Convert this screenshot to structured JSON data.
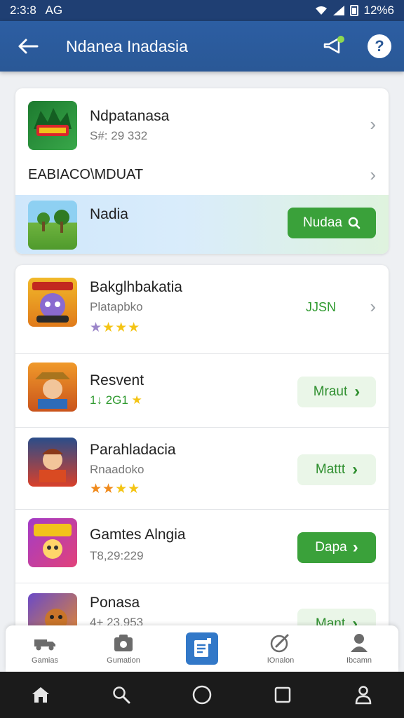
{
  "status_bar": {
    "time": "2:3:8",
    "carrier": "AG",
    "clock_right": "12%6"
  },
  "app_bar": {
    "title": "Ndanea Inadasia"
  },
  "featured_card": {
    "top_item": {
      "title": "Ndpatanasa",
      "subtitle": "S#: 29 332"
    },
    "section_row": {
      "label": "EABIACO\\MDUAT"
    },
    "highlight_item": {
      "title": "Nadia",
      "button_label": "Nudaa"
    }
  },
  "game_list": [
    {
      "title": "Bakglhbakatia",
      "subtitle": "Platapbko",
      "action": "JJSN",
      "action_style": "text",
      "rating": [
        "purple",
        "gold",
        "gold",
        "gold"
      ]
    },
    {
      "title": "Resvent",
      "subtitle": "1↓ 2G1",
      "action": "Mraut",
      "action_style": "light",
      "rating": [
        "gold"
      ]
    },
    {
      "title": "Parahladacia",
      "subtitle": "Rnaadoko",
      "action": "Mattt",
      "action_style": "light",
      "rating": [
        "orange",
        "orange",
        "gold",
        "gold"
      ]
    },
    {
      "title": "Gamtes Alngia",
      "subtitle": "T8,29:229",
      "action": "Dapa",
      "action_style": "green",
      "rating": []
    },
    {
      "title": "Ponasa",
      "subtitle": "4+ 23.953",
      "action": "Mant",
      "action_style": "light",
      "rating": []
    }
  ],
  "tab_bar": {
    "tabs": [
      {
        "label": "Gamias",
        "icon": "truck-icon"
      },
      {
        "label": "Gumation",
        "icon": "camera-icon"
      },
      {
        "label": "",
        "icon": "document-icon",
        "active": true
      },
      {
        "label": "IOnalon",
        "icon": "tag-icon"
      },
      {
        "label": "Ibcamn",
        "icon": "person-icon"
      }
    ]
  },
  "colors": {
    "app_bar": "#2a5896",
    "accent_green": "#3aa13a",
    "tab_active": "#3278c8"
  }
}
